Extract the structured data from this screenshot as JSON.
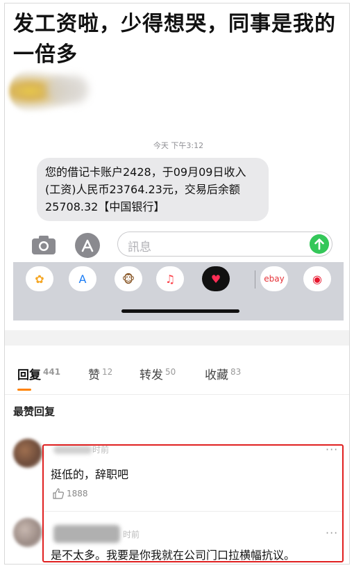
{
  "post": {
    "title": "发工资啦，少得想哭，同事是我的一倍多"
  },
  "sms": {
    "timestamp": "今天 下午3:12",
    "message": "您的借记卡账户2428，于09月09日收入(工资)人民币23764.23元，交易后余额25708.32【中国银行】"
  },
  "composer": {
    "placeholder": "訊息",
    "camera_icon": "camera-icon",
    "apps_icon": "app-store-icon",
    "send_icon": "send-arrow-icon"
  },
  "app_tray": {
    "apps": [
      {
        "name": "photos-icon",
        "glyph": "✿",
        "color": "#f5a623"
      },
      {
        "name": "app-store-icon",
        "glyph": "A",
        "color": "#1a7cf5"
      },
      {
        "name": "animoji-icon",
        "glyph": "🐵",
        "color": "#8b5a2b"
      },
      {
        "name": "music-icon",
        "glyph": "♫",
        "color": "#fc3c44"
      },
      {
        "name": "digital-touch-icon",
        "glyph": "♥",
        "color": "#ff2d55"
      },
      {
        "name": "ebay-icon",
        "glyph": "ebay",
        "color": "#e53238"
      },
      {
        "name": "weibo-icon",
        "glyph": "◉",
        "color": "#e6162d"
      }
    ]
  },
  "tabs": [
    {
      "label": "回复",
      "count": "441",
      "active": true
    },
    {
      "label": "赞",
      "count": "12",
      "active": false
    },
    {
      "label": "转发",
      "count": "50",
      "active": false
    },
    {
      "label": "收藏",
      "count": "83",
      "active": false
    }
  ],
  "comments_section": {
    "heading": "最赞回复"
  },
  "comments": [
    {
      "time": "时前",
      "text": "挺低的，辞职吧",
      "likes": "1888",
      "more": "···"
    },
    {
      "time": "时前",
      "text": "是不太多。我要是你我就在公司门口拉横幅抗议。",
      "more": "···"
    }
  ],
  "colors": {
    "accent_underline": "#ff8200",
    "highlight_border": "#e02020",
    "send_button": "#34c759",
    "bubble": "#e9e9eb"
  }
}
